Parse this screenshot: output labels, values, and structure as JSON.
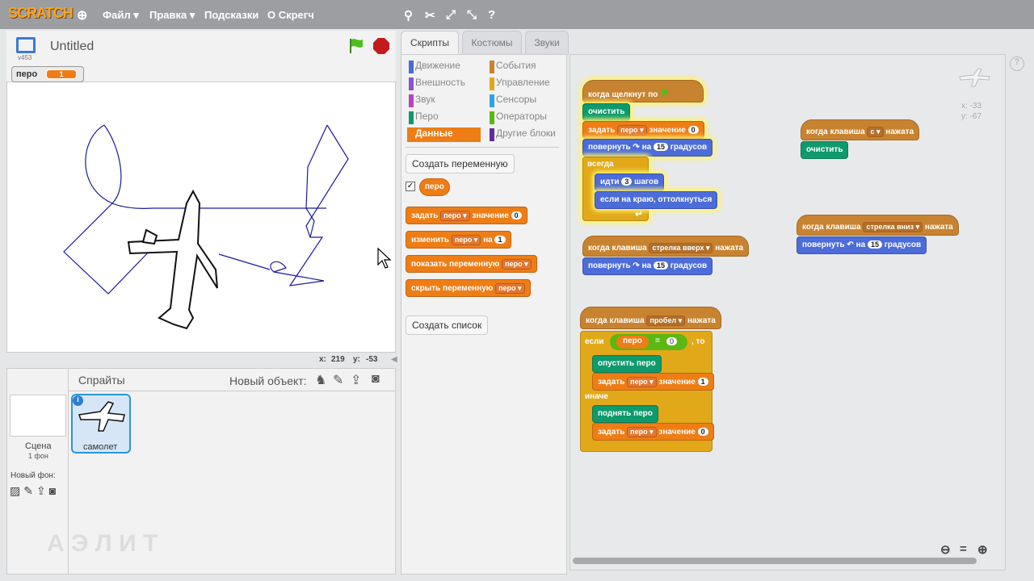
{
  "menu": {
    "logo": "SCRATCH",
    "file": "Файл ▾",
    "edit": "Правка ▾",
    "tips": "Подсказки",
    "about": "О Скрегч"
  },
  "stage": {
    "title": "Untitled",
    "version": "v453",
    "var_name": "перо",
    "var_value": "1",
    "x_label": "x:",
    "x_value": "219",
    "y_label": "y:",
    "y_value": "-53"
  },
  "sprites": {
    "header": "Спрайты",
    "new_object": "Новый объект:",
    "scene_label": "Сцена",
    "scene_sub": "1 фон",
    "new_bg": "Новый фон:",
    "sprite_name": "самолет",
    "watermark": "А Э Л И Т"
  },
  "tabs": [
    "Скрипты",
    "Костюмы",
    "Звуки"
  ],
  "categories": {
    "left": [
      {
        "label": "Движение",
        "color": "#4a6cd4"
      },
      {
        "label": "Внешность",
        "color": "#8a55d7"
      },
      {
        "label": "Звук",
        "color": "#bb42c3"
      },
      {
        "label": "Перо",
        "color": "#0e9a6c"
      },
      {
        "label": "Данные",
        "color": "#ee7d16"
      }
    ],
    "right": [
      {
        "label": "События",
        "color": "#c88330"
      },
      {
        "label": "Управление",
        "color": "#e1a91a"
      },
      {
        "label": "Сенсоры",
        "color": "#2ca5e2"
      },
      {
        "label": "Операторы",
        "color": "#5cb712"
      },
      {
        "label": "Другие блоки",
        "color": "#632d99"
      }
    ]
  },
  "palette": {
    "make_var": "Создать переменную",
    "var_block": "перо",
    "set": "задать",
    "to_value": "значение",
    "change": "изменить",
    "by": "на",
    "show_var": "показать переменную",
    "hide_var": "скрыть переменную",
    "val0": "0",
    "val1": "1",
    "make_list": "Создать список"
  },
  "script_labels": {
    "when_flag": "когда щелкнут по",
    "clear": "очистить",
    "set": "задать",
    "var": "перо",
    "value": "значение",
    "turn_right": "повернуть",
    "on": "на",
    "degrees": "градусов",
    "forever": "всегда",
    "move": "идти",
    "steps": "шагов",
    "bounce": "если на краю, оттолкнуться",
    "when_key": "когда клавиша",
    "pressed": "нажата",
    "key_c": "с",
    "key_up": "стрелка вверх",
    "key_down": "стрелка вниз",
    "key_space": "пробел",
    "if": "если",
    "then": ", то",
    "else": "иначе",
    "pen_down": "опустить перо",
    "pen_up": "поднять перо",
    "n0": "0",
    "n1": "1",
    "n3": "3",
    "n15": "15",
    "eq": "=",
    "mx": "x: -33",
    "my": "y: -67"
  }
}
